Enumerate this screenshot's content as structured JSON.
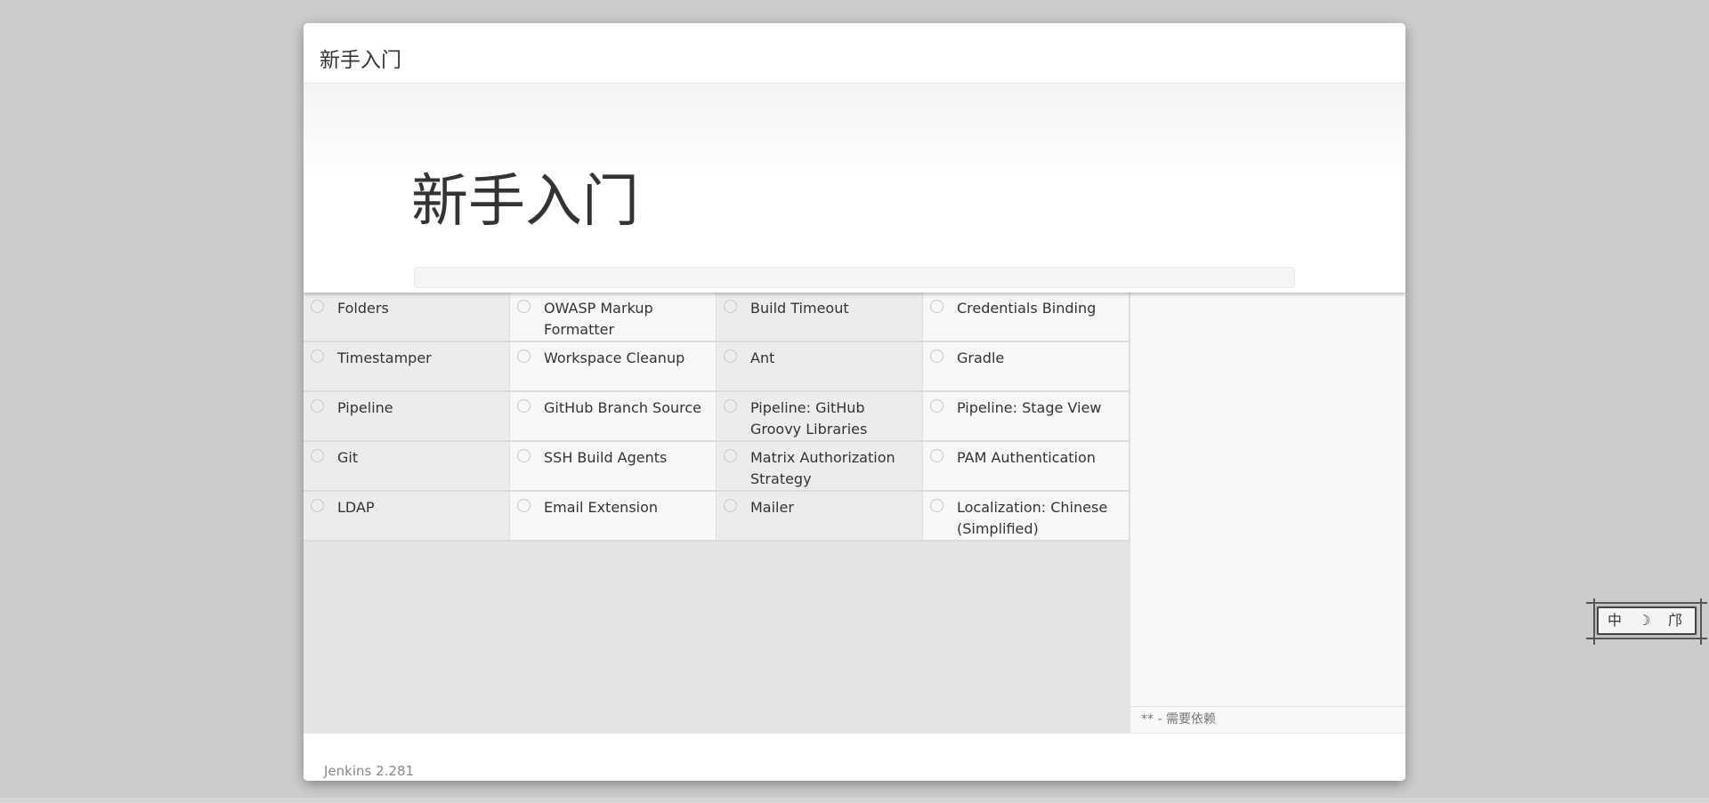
{
  "header": {
    "title": "新手入门"
  },
  "hero": {
    "title": "新手入门",
    "progress_percent": 0
  },
  "plugins": [
    [
      "Folders",
      "OWASP Markup Formatter",
      "Build Timeout",
      "Credentials Binding"
    ],
    [
      "Timestamper",
      "Workspace Cleanup",
      "Ant",
      "Gradle"
    ],
    [
      "Pipeline",
      "GitHub Branch Source",
      "Pipeline: GitHub Groovy Libraries",
      "Pipeline: Stage View"
    ],
    [
      "Git",
      "SSH Build Agents",
      "Matrix Authorization Strategy",
      "PAM Authentication"
    ],
    [
      "LDAP",
      "Email Extension",
      "Mailer",
      "Localization: Chinese (Simplified)"
    ]
  ],
  "legend": "** - 需要依赖",
  "footer": {
    "version": "Jenkins 2.281"
  },
  "ime": {
    "glyphs": [
      "中",
      "☽",
      "邝"
    ]
  },
  "colors": {
    "page_background": "#cccccc",
    "progress_fill": "#5cb85c"
  }
}
